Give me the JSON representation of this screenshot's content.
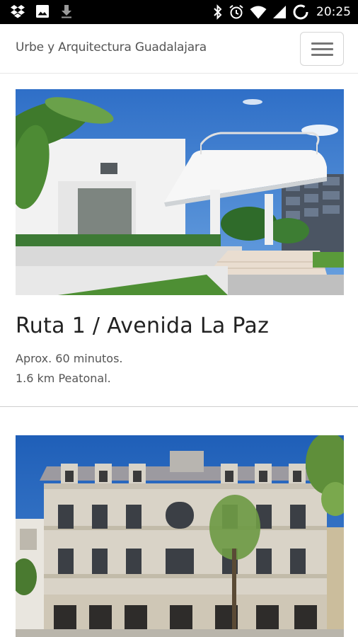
{
  "status_bar": {
    "time": "20:25",
    "left_icons": [
      "dropbox-icon",
      "image-icon",
      "download-icon"
    ],
    "right_icons": [
      "bluetooth-icon",
      "alarm-icon",
      "wifi-icon",
      "signal-icon",
      "battery-icon"
    ]
  },
  "header": {
    "brand": "Urbe y Arquitectura Guadalajara",
    "menu_icon": "hamburger-menu-icon"
  },
  "routes": [
    {
      "title": "Ruta 1 / Avenida La Paz",
      "duration": "Aprox. 60 minutos.",
      "distance": "1.6 km Peatonal."
    }
  ],
  "colors": {
    "status_bar_bg": "#000000",
    "brand_text": "#555555",
    "title_text": "#222222",
    "meta_text": "#555555",
    "sky": "#2f6fc7"
  }
}
